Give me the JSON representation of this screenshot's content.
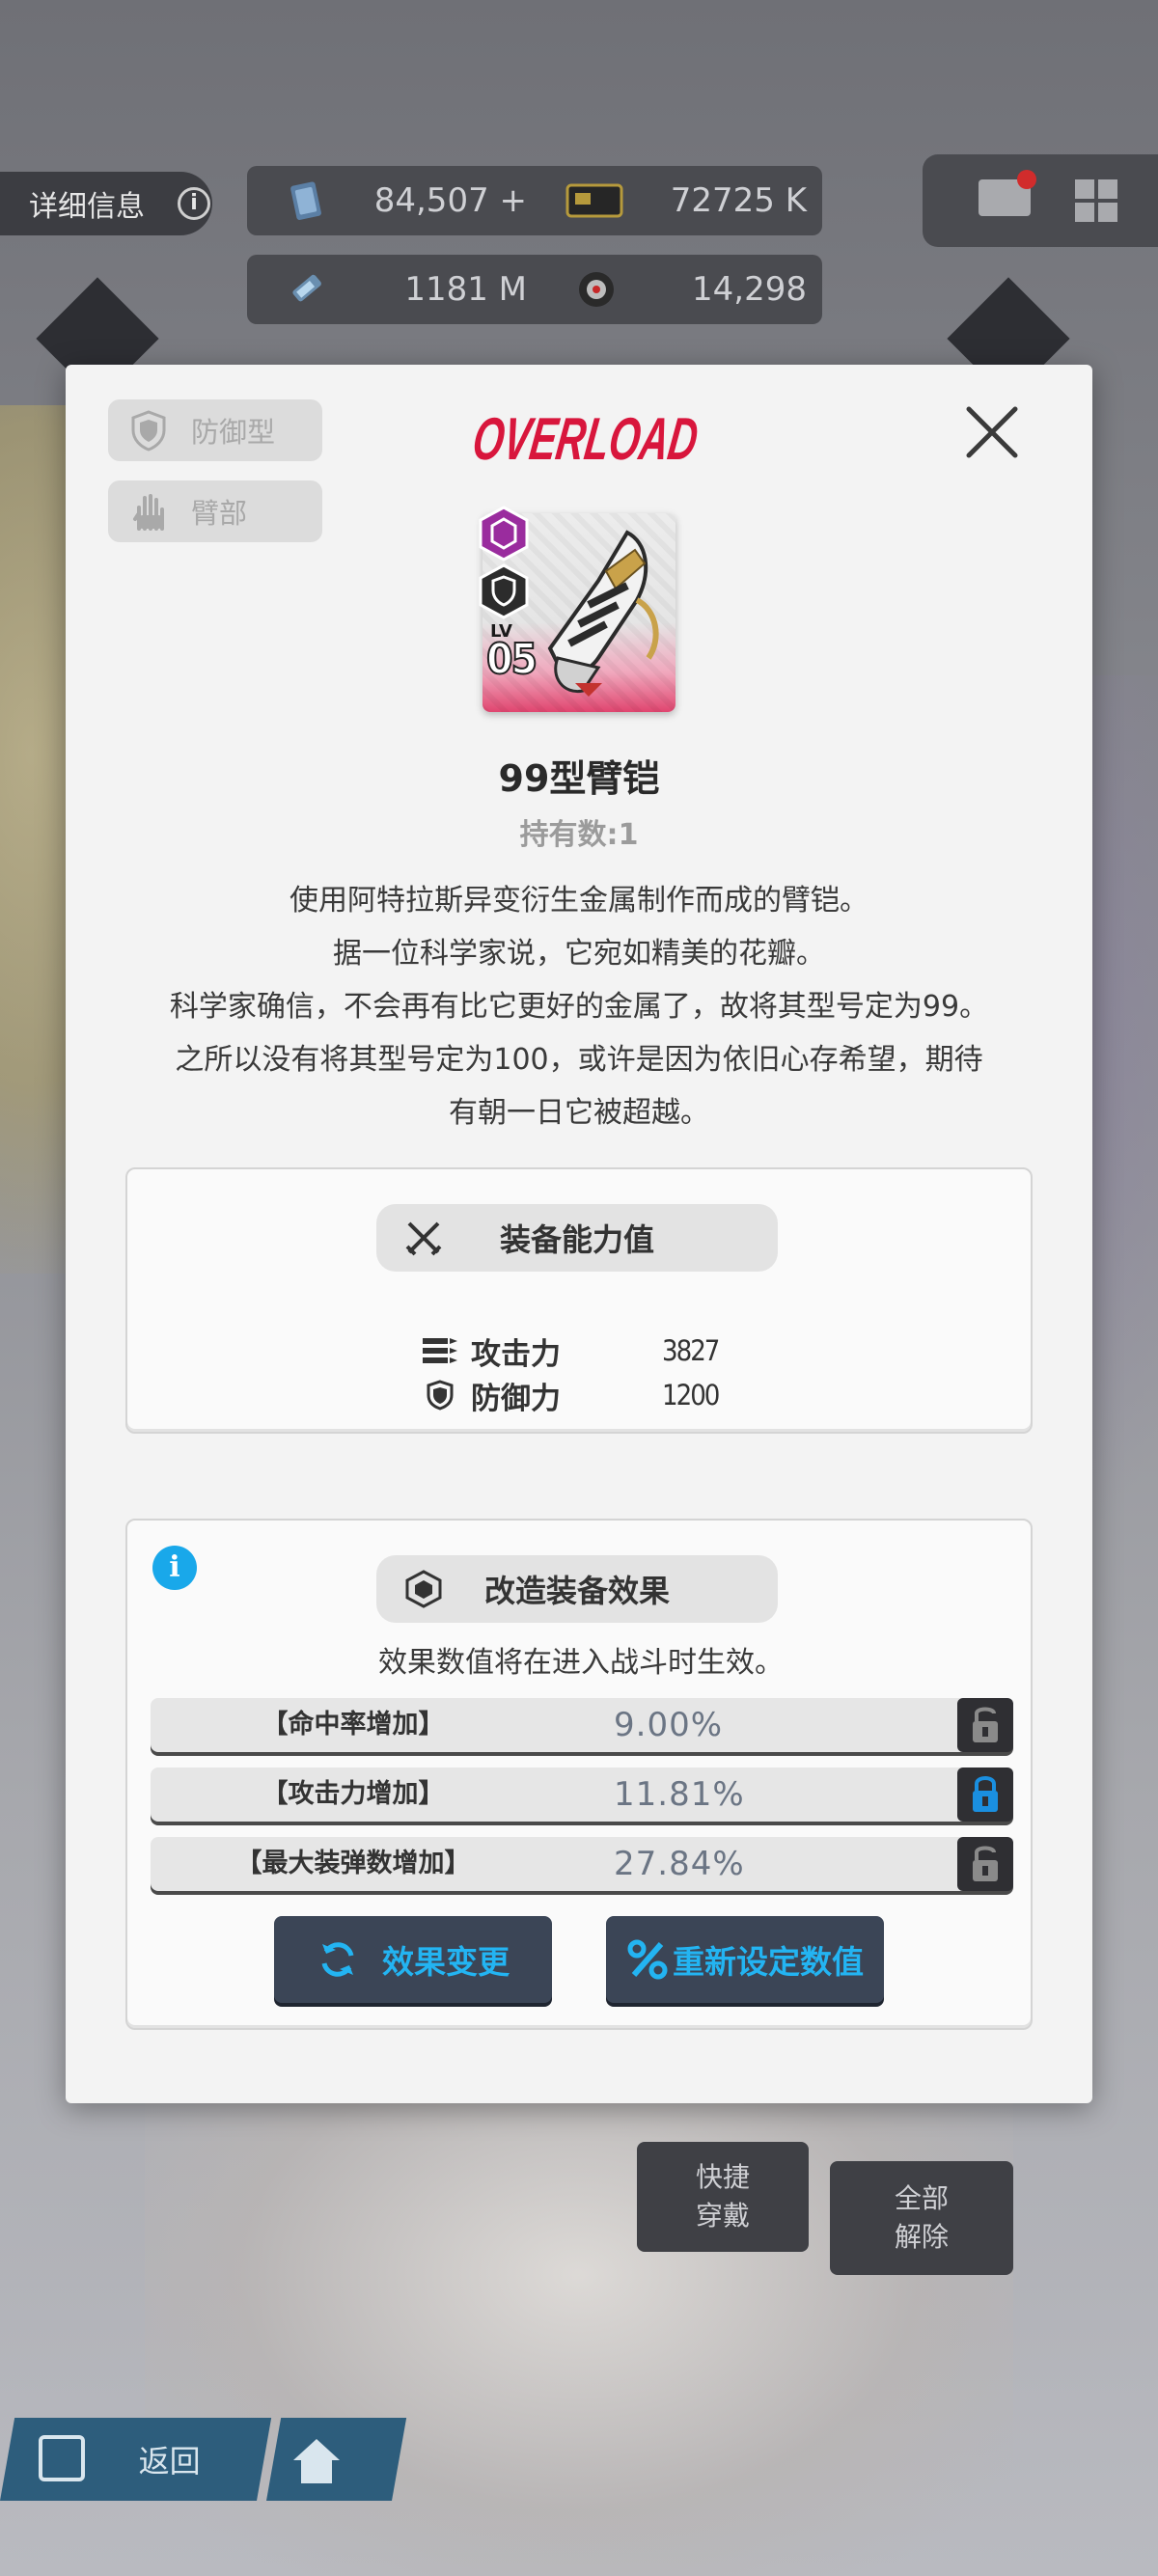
{
  "hud": {
    "detail_tab": "详细信息",
    "resources": [
      {
        "icon": "gem-card-icon",
        "value": "84,507 +"
      },
      {
        "icon": "credit-card-icon",
        "value": "72725 K"
      },
      {
        "icon": "battery-icon",
        "value": "1181 M"
      },
      {
        "icon": "core-orb-icon",
        "value": "14,298"
      }
    ]
  },
  "bottom": {
    "quick_equip": [
      "快捷",
      "穿戴"
    ],
    "unequip_all": [
      "全部",
      "解除"
    ],
    "back": "返回"
  },
  "modal": {
    "chips": [
      {
        "icon": "shield-icon",
        "label": "防御型"
      },
      {
        "icon": "hand-icon",
        "label": "臂部"
      }
    ],
    "logo_text": "OVERLOAD",
    "card": {
      "lv_label": "LV",
      "lv_value": "05"
    },
    "item_name": "99型臂铠",
    "owned_label": "持有数:",
    "owned_value": "1",
    "description": [
      "使用阿特拉斯异变衍生金属制作而成的臂铠。",
      "据一位科学家说，它宛如精美的花瓣。",
      "科学家确信，不会再有比它更好的金属了，故将其型号定为99。",
      "之所以没有将其型号定为100，或许是因为依旧心存希望，期待",
      "有朝一日它被超越。"
    ],
    "stats_panel": {
      "title": "装备能力值",
      "stats": [
        {
          "name": "攻击力",
          "value": "3827"
        },
        {
          "name": "防御力",
          "value": "1200"
        }
      ]
    },
    "effects_panel": {
      "title": "改造装备效果",
      "note": "效果数值将在进入战斗时生效。",
      "effects": [
        {
          "name": "【命中率增加】",
          "value": "9.00%",
          "locked": false
        },
        {
          "name": "【攻击力增加】",
          "value": "11.81%",
          "locked": true
        },
        {
          "name": "【最大装弹数增加】",
          "value": "27.84%",
          "locked": false
        }
      ],
      "change_button": "效果变更",
      "reset_button": "重新设定数值"
    }
  },
  "colors": {
    "accent_blue": "#23b4f2",
    "logo_red": "#d8163c",
    "rarity_purple": "#9a2c9e",
    "lock_active": "#1a8fe0"
  }
}
